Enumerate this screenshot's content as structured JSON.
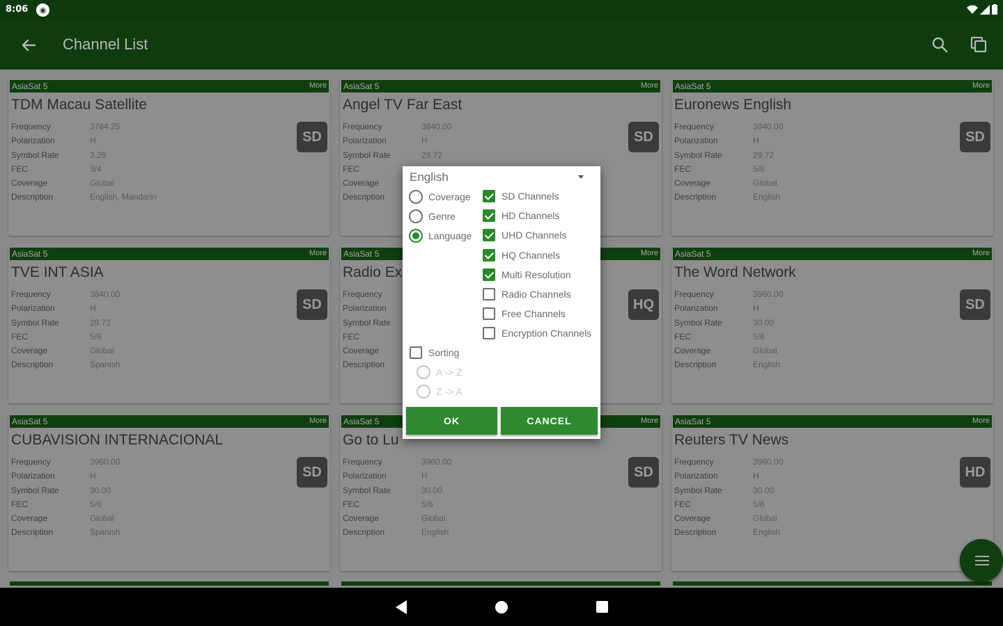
{
  "status_bar": {
    "time": "8:06"
  },
  "toolbar": {
    "title": "Channel List"
  },
  "colors": {
    "primary_dark": "#0e3c0e",
    "accent_green": "#2e8a2e",
    "scrim_gray": "#8e8e8e"
  },
  "field_labels": [
    "Frequency",
    "Polarization",
    "Symbol Rate",
    "FEC",
    "Coverage",
    "Description"
  ],
  "more_label": "More",
  "cards": [
    {
      "satellite": "AsiaSat 5",
      "name": "TDM Macau Satellite",
      "badge": "SD",
      "values": [
        "3784.25",
        "H",
        "3.26",
        "3/4",
        "Global",
        "English, Mandarin"
      ]
    },
    {
      "satellite": "AsiaSat 5",
      "name": "Angel TV Far East",
      "badge": "SD",
      "values": [
        "3840.00",
        "H",
        "29.72",
        "",
        "",
        ""
      ]
    },
    {
      "satellite": "AsiaSat 5",
      "name": "Euronews English",
      "badge": "SD",
      "values": [
        "3840.00",
        "H",
        "29.72",
        "5/6",
        "Global",
        "English"
      ]
    },
    {
      "satellite": "AsiaSat 5",
      "name": "TVE INT ASIA",
      "badge": "SD",
      "values": [
        "3840.00",
        "H",
        "29.72",
        "5/6",
        "Global",
        "Spanish"
      ]
    },
    {
      "satellite": "AsiaSat 5",
      "name": "Radio Ex",
      "badge": "HQ",
      "values": [
        "",
        "",
        "",
        "",
        "",
        ""
      ]
    },
    {
      "satellite": "AsiaSat 5",
      "name": "The Word Network",
      "badge": "SD",
      "values": [
        "3960.00",
        "H",
        "30.00",
        "5/6",
        "Global",
        "English"
      ]
    },
    {
      "satellite": "AsiaSat 5",
      "name": "CUBAVISION INTERNACIONAL",
      "badge": "SD",
      "values": [
        "3960.00",
        "H",
        "30.00",
        "5/6",
        "Global",
        "Spanish"
      ]
    },
    {
      "satellite": "AsiaSat 5",
      "name": "Go to Lu",
      "badge": "SD",
      "values": [
        "3960.00",
        "H",
        "30.00",
        "5/6",
        "Global",
        "English"
      ]
    },
    {
      "satellite": "AsiaSat 5",
      "name": "Reuters TV News",
      "badge": "HD",
      "values": [
        "3960.00",
        "H",
        "30.00",
        "5/6",
        "Global",
        "English"
      ]
    }
  ],
  "dialog": {
    "dropdown_value": "English",
    "group_options": [
      {
        "label": "Coverage",
        "selected": false
      },
      {
        "label": "Genre",
        "selected": false
      },
      {
        "label": "Language",
        "selected": true
      }
    ],
    "channel_filters": [
      {
        "label": "SD Channels",
        "checked": true
      },
      {
        "label": "HD Channels",
        "checked": true
      },
      {
        "label": "UHD Channels",
        "checked": true
      },
      {
        "label": "HQ Channels",
        "checked": true
      },
      {
        "label": "Multi Resolution",
        "checked": true
      },
      {
        "label": "Radio Channels",
        "checked": false
      },
      {
        "label": "Free Channels",
        "checked": false
      },
      {
        "label": "Encryption Channels",
        "checked": false
      }
    ],
    "sorting": {
      "label": "Sorting",
      "checked": false,
      "options": [
        "A -> Z",
        "Z -> A"
      ]
    },
    "ok_label": "OK",
    "cancel_label": "CANCEL"
  }
}
